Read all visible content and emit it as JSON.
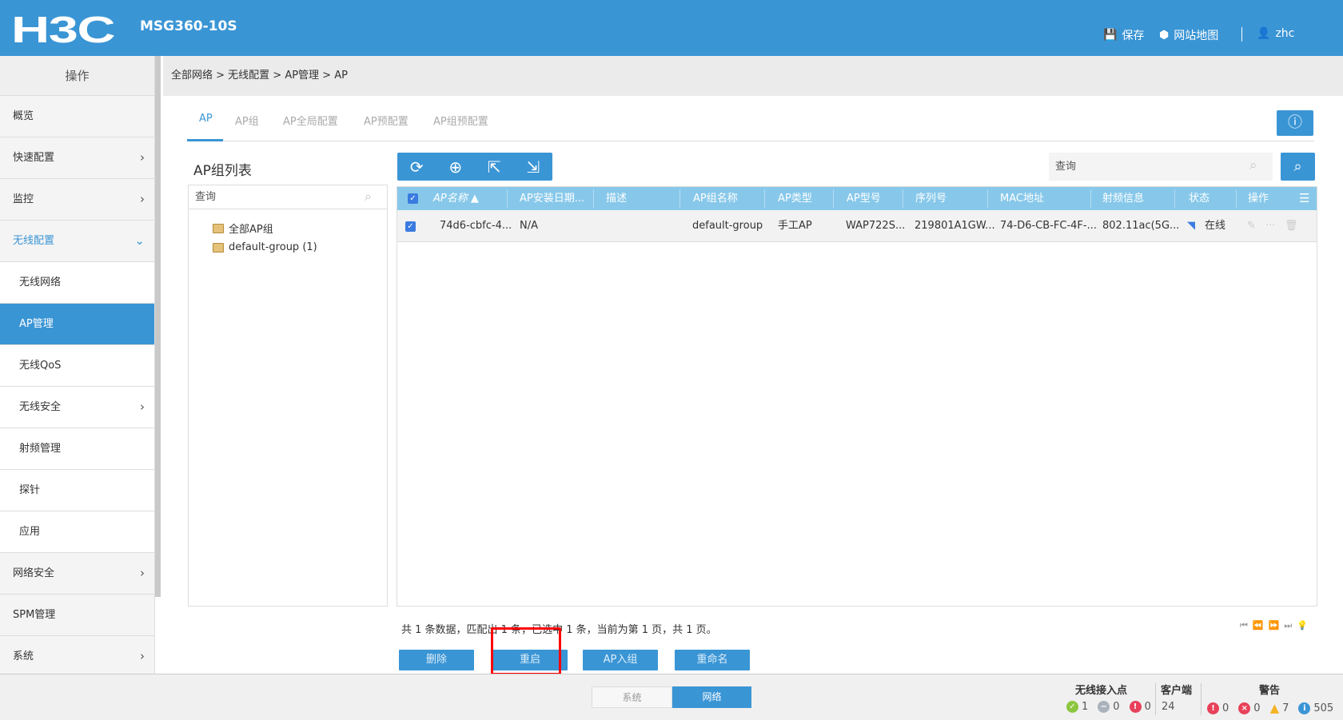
{
  "header": {
    "logo": "H3C",
    "model": "MSG360-10S",
    "save": "保存",
    "sitemap": "网站地图",
    "user": "zhc"
  },
  "sidebar": {
    "title": "操作",
    "items": [
      {
        "label": "概览"
      },
      {
        "label": "快速配置"
      },
      {
        "label": "监控"
      },
      {
        "label": "无线配置"
      },
      {
        "label": "无线网络"
      },
      {
        "label": "AP管理"
      },
      {
        "label": "无线QoS"
      },
      {
        "label": "无线安全"
      },
      {
        "label": "射频管理"
      },
      {
        "label": "探针"
      },
      {
        "label": "应用"
      },
      {
        "label": "网络安全"
      },
      {
        "label": "SPM管理"
      },
      {
        "label": "系统"
      }
    ]
  },
  "breadcrumb": "全部网络 > 无线配置 > AP管理 > AP",
  "tabs": [
    "AP",
    "AP组",
    "AP全局配置",
    "AP预配置",
    "AP组预配置"
  ],
  "group_panel": {
    "title": "AP组列表",
    "search_placeholder": "查询",
    "nodes": [
      "全部AP组",
      "default-group (1)"
    ]
  },
  "search": {
    "placeholder": "查询"
  },
  "table": {
    "columns": [
      "AP名称",
      "AP安装日期...",
      "描述",
      "AP组名称",
      "AP类型",
      "AP型号",
      "序列号",
      "MAC地址",
      "射频信息",
      "状态",
      "操作"
    ],
    "rows": [
      {
        "name": "74d6-cbfc-4...",
        "date": "N/A",
        "desc": "",
        "group": "default-group",
        "type": "手工AP",
        "model": "WAP722S...",
        "serial": "219801A1GW...",
        "mac": "74-D6-CB-FC-4F-...",
        "radio": "802.11ac(5G...",
        "status": "在线"
      }
    ]
  },
  "footer": {
    "info": "共 1 条数据，匹配出 1 条，已选中 1 条，当前为第 1 页，共 1 页。",
    "buttons": [
      "删除",
      "重启",
      "AP入组",
      "重命名"
    ]
  },
  "bottom": {
    "seg": [
      "系统",
      "网络"
    ],
    "ap_title": "无线接入点",
    "ap": [
      "1",
      "0",
      "0"
    ],
    "client_title": "客户端",
    "clients": "24",
    "alarm_title": "警告",
    "alarms": [
      "0",
      "0",
      "7",
      "505"
    ]
  }
}
